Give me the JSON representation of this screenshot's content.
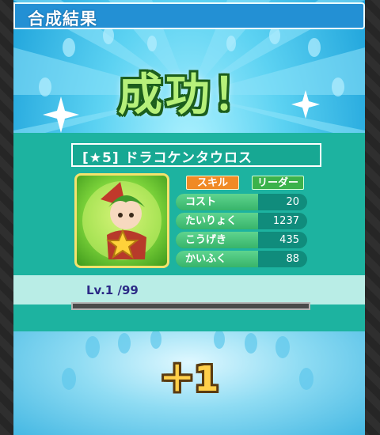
{
  "header": {
    "title": "合成結果"
  },
  "result": {
    "message": "成功！",
    "bonus": "＋1"
  },
  "monster": {
    "name": "[★5] ドラコケンタウロス",
    "level": "Lv.1 /99",
    "xp_progress": 0.0,
    "tabs": {
      "skill": "スキル",
      "leader": "リーダー"
    },
    "stats": [
      {
        "label": "コスト",
        "value": "20"
      },
      {
        "label": "たいりょく",
        "value": "1237"
      },
      {
        "label": "こうげき",
        "value": "435"
      },
      {
        "label": "かいふく",
        "value": "88"
      }
    ]
  },
  "colors": {
    "panel_blue": "#26a9de",
    "card_teal": "#1db3a0",
    "success_green": "#b6f07a",
    "skill_orange": "#f08a25",
    "leader_green": "#3bb24b",
    "bonus_yellow": "#ffd04a"
  }
}
